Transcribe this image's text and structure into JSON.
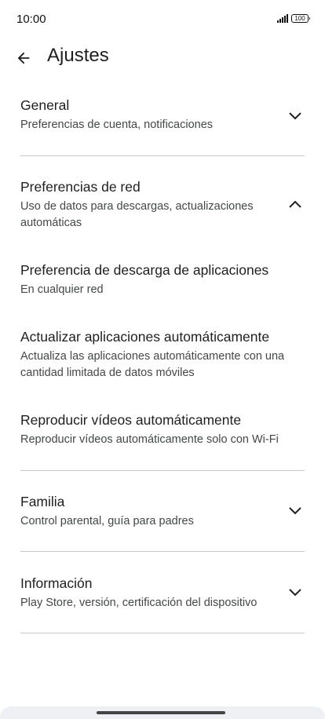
{
  "status_bar": {
    "time": "10:00",
    "battery": "100"
  },
  "app_bar": {
    "title": "Ajustes"
  },
  "sections": [
    {
      "title": "General",
      "subtitle": "Preferencias de cuenta, notificaciones",
      "expanded": false
    },
    {
      "title": "Preferencias de red",
      "subtitle": "Uso de datos para descargas, actualizaciones automáticas",
      "expanded": true,
      "items": [
        {
          "title": "Preferencia de descarga de aplicaciones",
          "subtitle": "En cualquier red"
        },
        {
          "title": "Actualizar aplicaciones automáticamente",
          "subtitle": "Actualiza las aplicaciones automáticamente con una cantidad limitada de datos móviles"
        },
        {
          "title": "Reproducir vídeos automáticamente",
          "subtitle": "Reproducir vídeos automáticamente solo con Wi-Fi"
        }
      ]
    },
    {
      "title": "Familia",
      "subtitle": "Control parental, guía para padres",
      "expanded": false
    },
    {
      "title": "Información",
      "subtitle": "Play Store, versión, certificación del dispositivo",
      "expanded": false
    }
  ],
  "icons": {
    "back": "arrow-back-icon",
    "collapse": "chevron-up-icon",
    "expand": "chevron-down-icon"
  }
}
